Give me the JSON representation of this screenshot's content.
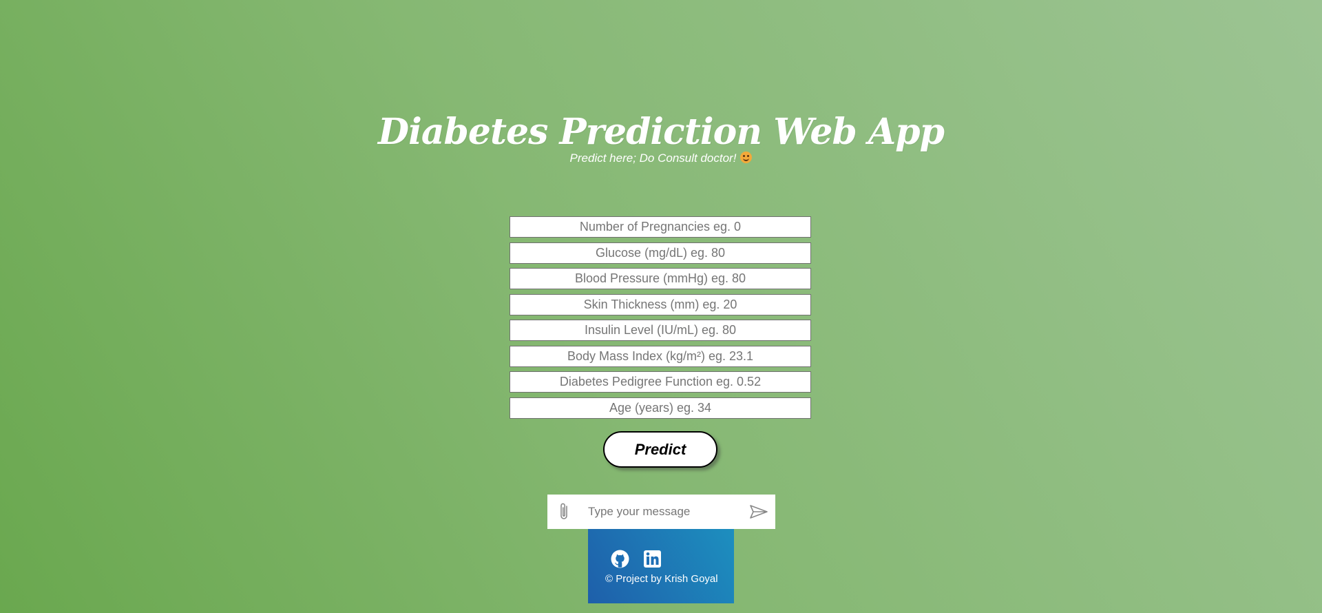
{
  "header": {
    "title": "Diabetes Prediction Web App",
    "subtitle": "Predict here; Do Consult doctor!",
    "subtitle_emoji": "smiling-face-icon"
  },
  "form": {
    "fields": [
      {
        "placeholder": "Number of Pregnancies eg. 0",
        "value": ""
      },
      {
        "placeholder": "Glucose (mg/dL) eg. 80",
        "value": ""
      },
      {
        "placeholder": "Blood Pressure (mmHg) eg. 80",
        "value": ""
      },
      {
        "placeholder": "Skin Thickness (mm) eg. 20",
        "value": ""
      },
      {
        "placeholder": "Insulin Level (IU/mL) eg. 80",
        "value": ""
      },
      {
        "placeholder": "Body Mass Index (kg/m²) eg. 23.1",
        "value": ""
      },
      {
        "placeholder": "Diabetes Pedigree Function eg. 0.52",
        "value": ""
      },
      {
        "placeholder": "Age (years) eg. 34",
        "value": ""
      }
    ],
    "submit_label": "Predict"
  },
  "chat": {
    "placeholder": "Type your message",
    "value": "",
    "attach_icon": "paperclip-icon",
    "send_icon": "send-icon"
  },
  "footer": {
    "icons": [
      "github-icon",
      "linkedin-icon"
    ],
    "credit": "© Project by Krish Goyal"
  },
  "colors": {
    "background_start": "#6aa84f",
    "background_end": "#9cc493",
    "footer_start": "#1e5faa",
    "footer_end": "#1d8fbf",
    "text_primary": "#ffffff"
  }
}
